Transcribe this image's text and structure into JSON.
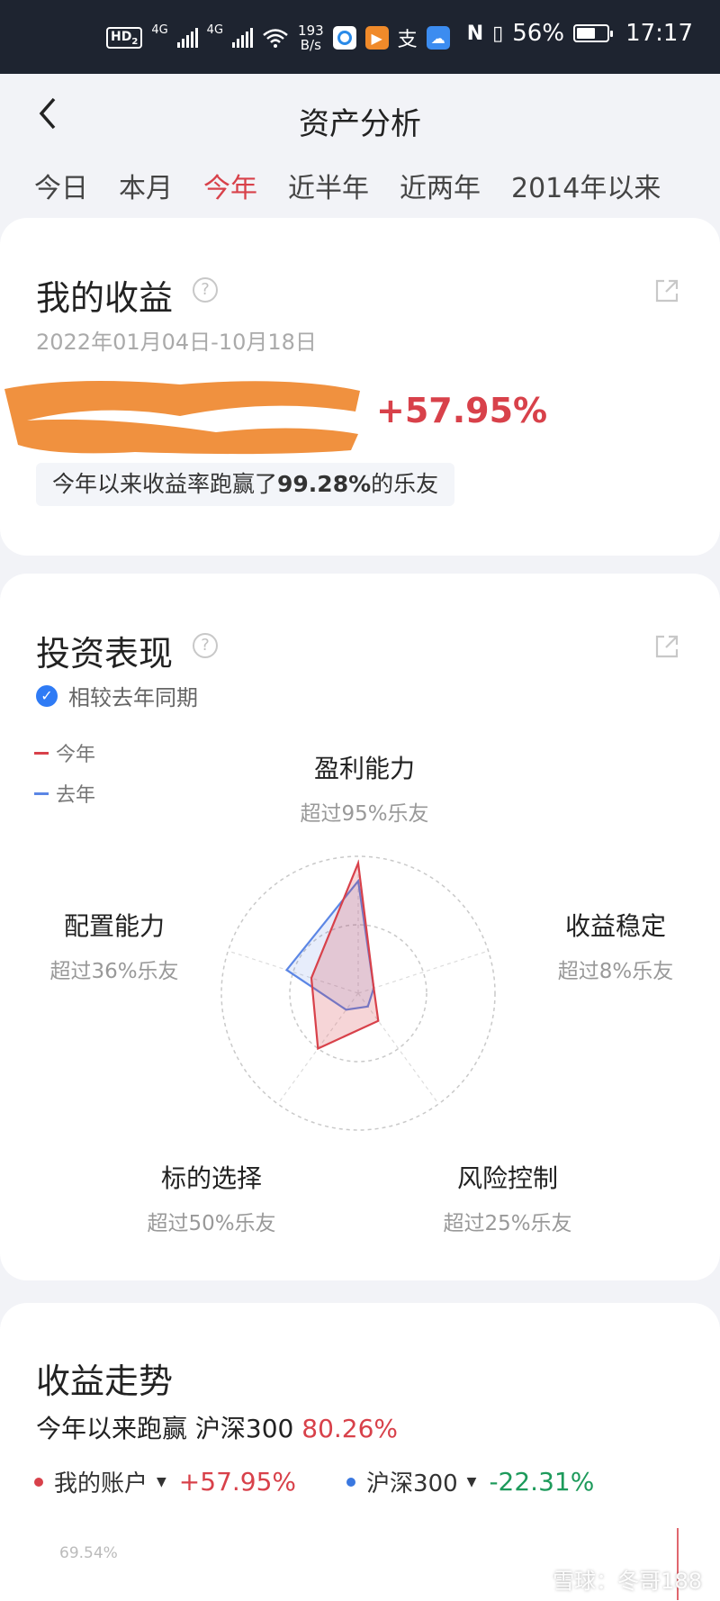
{
  "status_bar": {
    "hd_label": "HD",
    "hd_sub": "2",
    "network_1": "4G",
    "network_2": "4G",
    "speed_value": "193",
    "speed_unit": "B/s",
    "alipay_glyph": "支",
    "battery": "56%",
    "time": "17:17"
  },
  "header": {
    "back_icon": "chevron-left-icon",
    "title": "资产分析"
  },
  "tabs": [
    {
      "label": "今日",
      "active": false
    },
    {
      "label": "本月",
      "active": false
    },
    {
      "label": "今年",
      "active": true
    },
    {
      "label": "近半年",
      "active": false
    },
    {
      "label": "近两年",
      "active": false
    },
    {
      "label": "2014年以来",
      "active": false
    }
  ],
  "earnings": {
    "title": "我的收益",
    "date_range": "2022年01月04日-10月18日",
    "return_pct": "+57.95%",
    "beat_prefix": "今年以来收益率跑赢了",
    "beat_value": "99.28%",
    "beat_suffix": "的乐友"
  },
  "performance": {
    "title": "投资表现",
    "compare_label": "相较去年同期",
    "legend_this_year": "今年",
    "legend_last_year": "去年",
    "this_year_color": "#d8414a",
    "last_year_color": "#5b86e5",
    "axes": [
      {
        "name": "盈利能力",
        "beat": "超过95%乐友",
        "this_year": 0.95,
        "last_year": 0.82
      },
      {
        "name": "收益稳定",
        "beat": "超过8%乐友",
        "this_year": 0.08,
        "last_year": 0.1
      },
      {
        "name": "风险控制",
        "beat": "超过25%乐友",
        "this_year": 0.25,
        "last_year": 0.12
      },
      {
        "name": "标的选择",
        "beat": "超过50%乐友",
        "this_year": 0.5,
        "last_year": 0.15
      },
      {
        "name": "配置能力",
        "beat": "超过36%乐友",
        "this_year": 0.36,
        "last_year": 0.55
      }
    ]
  },
  "trend": {
    "title": "收益走势",
    "beat_prefix": "今年以来跑赢 沪深300",
    "beat_value": "80.26%",
    "my_account_label": "我的账户",
    "my_account_pct": "+57.95%",
    "index_label": "沪深300",
    "index_pct": "-22.31%",
    "y_top_label": "69.54%",
    "red": "#d8414a",
    "green": "#1d9a5b",
    "blue": "#3a78e0"
  },
  "watermark": "雪球：冬哥188"
}
